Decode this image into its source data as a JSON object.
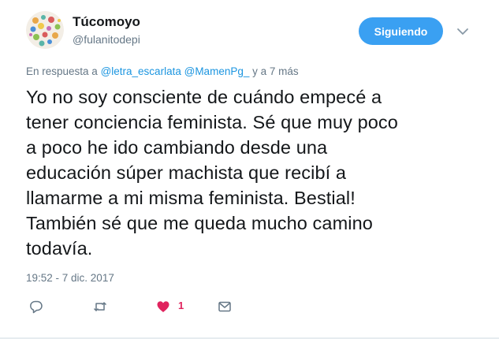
{
  "author": {
    "display_name": "Túcomoyo",
    "handle": "@fulanitodepi"
  },
  "follow_button": {
    "label": "Siguiendo",
    "color": "#3aa0f2"
  },
  "reply": {
    "prefix": "En respuesta a",
    "mention_1": "@letra_escarlata",
    "mention_2": "@MamenPg_",
    "suffix": "y a 7 más"
  },
  "tweet": {
    "lines": [
      "Yo no soy consciente de cuándo empecé a",
      "tener conciencia feminista. Sé que muy poco",
      "a poco he ido cambiando desde una",
      "educación súper machista que recibí a",
      "llamarme a mi misma feminista. Bestial!",
      "También sé que me queda mucho camino",
      "todavía."
    ],
    "timestamp": "19:52 - 7 dic. 2017"
  },
  "actions": {
    "reply_icon": "speech-bubble-icon",
    "retweet_icon": "retweet-icon",
    "like_icon": "heart-icon",
    "like_count": "1",
    "like_color": "#e0245e",
    "message_icon": "envelope-icon"
  },
  "colors": {
    "text": "#14171a",
    "muted": "#657786",
    "link": "#1b95e0"
  }
}
